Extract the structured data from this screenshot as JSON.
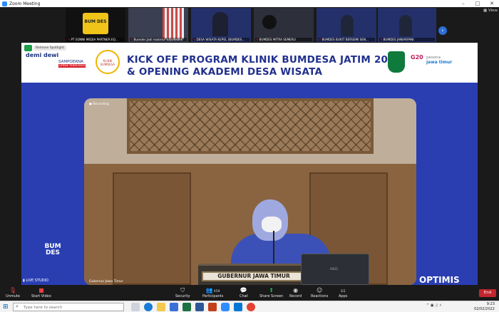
{
  "window": {
    "title": "Zoom Meeting",
    "controls": [
      "–",
      "□",
      "✕"
    ]
  },
  "strip": {
    "view_label": "View",
    "tiles": [
      {
        "label": "PT SONNI MEDIA PARTNER EQ..."
      },
      {
        "label": "Bumdes Jadi makmur kayokebek"
      },
      {
        "label": "DESA WISATA KEPEL (BUMDES..."
      },
      {
        "label": "BUMDES MITRA SEMERU"
      },
      {
        "label": "BUMDES BUKIT BERSEMI SEN..."
      },
      {
        "label": "BUMDES JANIARPANI"
      }
    ]
  },
  "share": {
    "spotlight": "Remove Spotlight",
    "title_line1": "KICK OFF PROGRAM KLINIK BUMDESA JATIM 2022",
    "title_line2": "& OPENING AKADEMI DESA WISATA",
    "logos": {
      "demi_dewi": "demi dewi",
      "sampoerna": "SAMPOERNA",
      "sampoerna_sub": "untuk Indonesia",
      "klinik": "KLINIK BUMDESA",
      "g20": "G20",
      "pesona": "pesona",
      "jawa_timur": "jawa timur"
    },
    "video_label": "Recording",
    "podium_sign": "GUBERNUR JAWA TIMUR",
    "laptop_brand": "ASUS",
    "video_caption": "Gubernur Jawa Timur",
    "bumdes_logo": "BUM DES",
    "live_label": "LIVE STUDIO",
    "optimis": "OPTIMIS"
  },
  "toolbar": {
    "unmute": "Unmute",
    "start_video": "Start Video",
    "security": "Security",
    "participants": "Participants",
    "participants_count": "459",
    "chat": "Chat",
    "share_screen": "Share Screen",
    "record": "Record",
    "reactions": "Reactions",
    "apps": "Apps",
    "end": "End"
  },
  "taskbar": {
    "search_placeholder": "Type here to search",
    "time": "9:23",
    "date": "02/02/2022",
    "apps": [
      "task-view",
      "edge",
      "file-explorer",
      "store",
      "excel",
      "word",
      "powerpoint",
      "zoom",
      "mail",
      "chrome"
    ]
  }
}
